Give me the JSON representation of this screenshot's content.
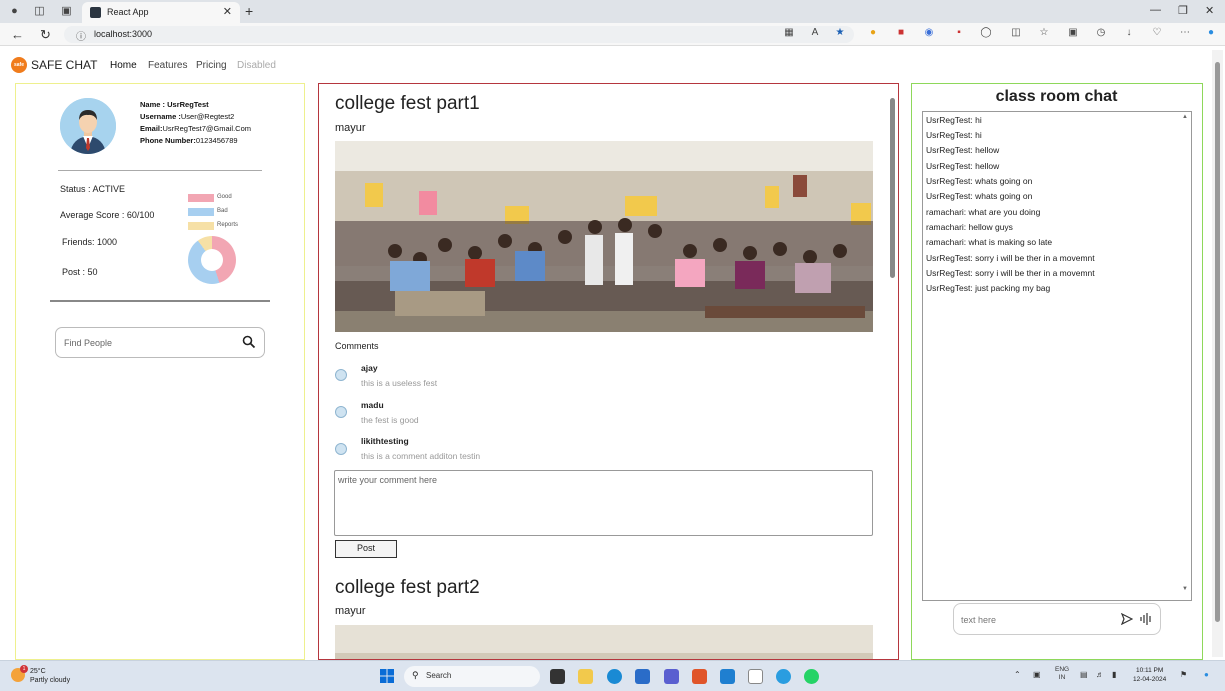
{
  "browser": {
    "tab_title": "React App",
    "url": "localhost:3000"
  },
  "nav": {
    "brand": "SAFE CHAT",
    "logo_text": "safe",
    "links": [
      "Home",
      "Features",
      "Pricing",
      "Disabled"
    ]
  },
  "profile": {
    "name_label": "Name :",
    "name": "UsrRegTest",
    "username_label": "Username :",
    "username": "User@Regtest2",
    "email_label": "Email:",
    "email": "UsrRegTest7@Gmail.Com",
    "phone_label": "Phone Number:",
    "phone": "0123456789",
    "status": "Status : ACTIVE",
    "score": "Average Score : 60/100",
    "friends": "Friends: 1000",
    "post": "Post : 50",
    "legend": [
      {
        "label": "Good",
        "color": "#f2a6b3"
      },
      {
        "label": "Bad",
        "color": "#a7cff0"
      },
      {
        "label": "Reports",
        "color": "#f6e0a6"
      }
    ],
    "search_placeholder": "Find People"
  },
  "posts": [
    {
      "title": "college fest part1",
      "author": "mayur",
      "comments_heading": "Comments",
      "comments": [
        {
          "name": "ajay",
          "text": "this is a useless fest"
        },
        {
          "name": "madu",
          "text": "the fest is good"
        },
        {
          "name": "likithtesting",
          "text": "this is a comment additon testin"
        }
      ],
      "comment_placeholder": "write your comment here",
      "post_button": "Post"
    },
    {
      "title": "college fest part2",
      "author": "mayur"
    }
  ],
  "chat": {
    "title": "class room chat",
    "messages": [
      "UsrRegTest: hi",
      "UsrRegTest: hi",
      "UsrRegTest: hellow",
      "UsrRegTest: hellow",
      "UsrRegTest: whats going on",
      "UsrRegTest: whats going on",
      "ramachari: what are you doing",
      "ramachari: hellow guys",
      "ramachari: what is making so late",
      "UsrRegTest: sorry i will be ther in a movemnt",
      "UsrRegTest: sorry i will be ther in a movemnt",
      "UsrRegTest: just packing my bag"
    ],
    "input_placeholder": "text here"
  },
  "taskbar": {
    "temp": "25°C",
    "weather": "Partly cloudy",
    "search": "Search",
    "lang1": "ENG",
    "lang2": "IN",
    "time": "10:11 PM",
    "date": "12-04-2024",
    "badge": "1"
  }
}
